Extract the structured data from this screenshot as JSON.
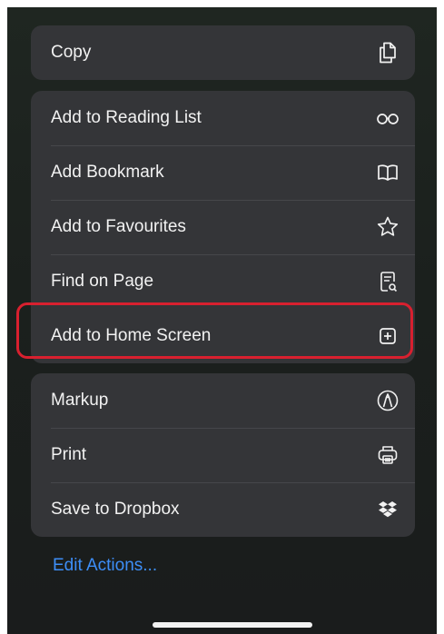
{
  "groups": [
    {
      "items": [
        {
          "label": "Copy",
          "icon": "copy-icon"
        }
      ]
    },
    {
      "items": [
        {
          "label": "Add to Reading List",
          "icon": "reading-glasses-icon"
        },
        {
          "label": "Add Bookmark",
          "icon": "book-icon"
        },
        {
          "label": "Add to Favourites",
          "icon": "star-icon"
        },
        {
          "label": "Find on Page",
          "icon": "find-document-icon"
        },
        {
          "label": "Add to Home Screen",
          "icon": "plus-square-icon"
        }
      ]
    },
    {
      "items": [
        {
          "label": "Markup",
          "icon": "markup-pen-icon"
        },
        {
          "label": "Print",
          "icon": "printer-icon"
        },
        {
          "label": "Save to Dropbox",
          "icon": "dropbox-icon"
        }
      ]
    }
  ],
  "edit_actions_label": "Edit Actions...",
  "colors": {
    "highlight": "#d8202f",
    "link": "#3d8ef7",
    "panel": "#343538"
  }
}
